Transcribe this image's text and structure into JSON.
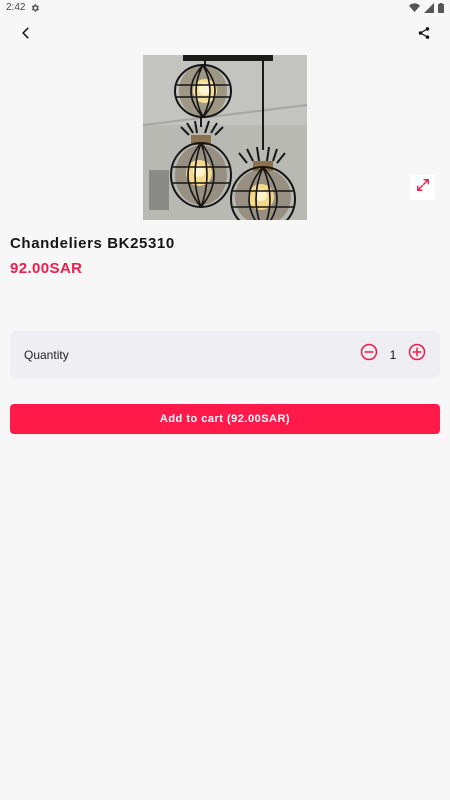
{
  "status_bar": {
    "time": "2:42"
  },
  "product": {
    "title": "Chandeliers BK25310",
    "price": "92.00SAR"
  },
  "quantity": {
    "label": "Quantity",
    "value": "1"
  },
  "cart": {
    "button_label": "Add to cart (92.00SAR)"
  },
  "colors": {
    "accent": "#ff1a4a",
    "price": "#ee1c4a",
    "card": "#efeff3",
    "background": "#f7f7f8"
  },
  "icons": [
    "gear-icon",
    "wifi-icon",
    "signal-icon",
    "battery-icon",
    "back-icon",
    "share-icon",
    "expand-icon",
    "minus-icon",
    "plus-icon"
  ]
}
